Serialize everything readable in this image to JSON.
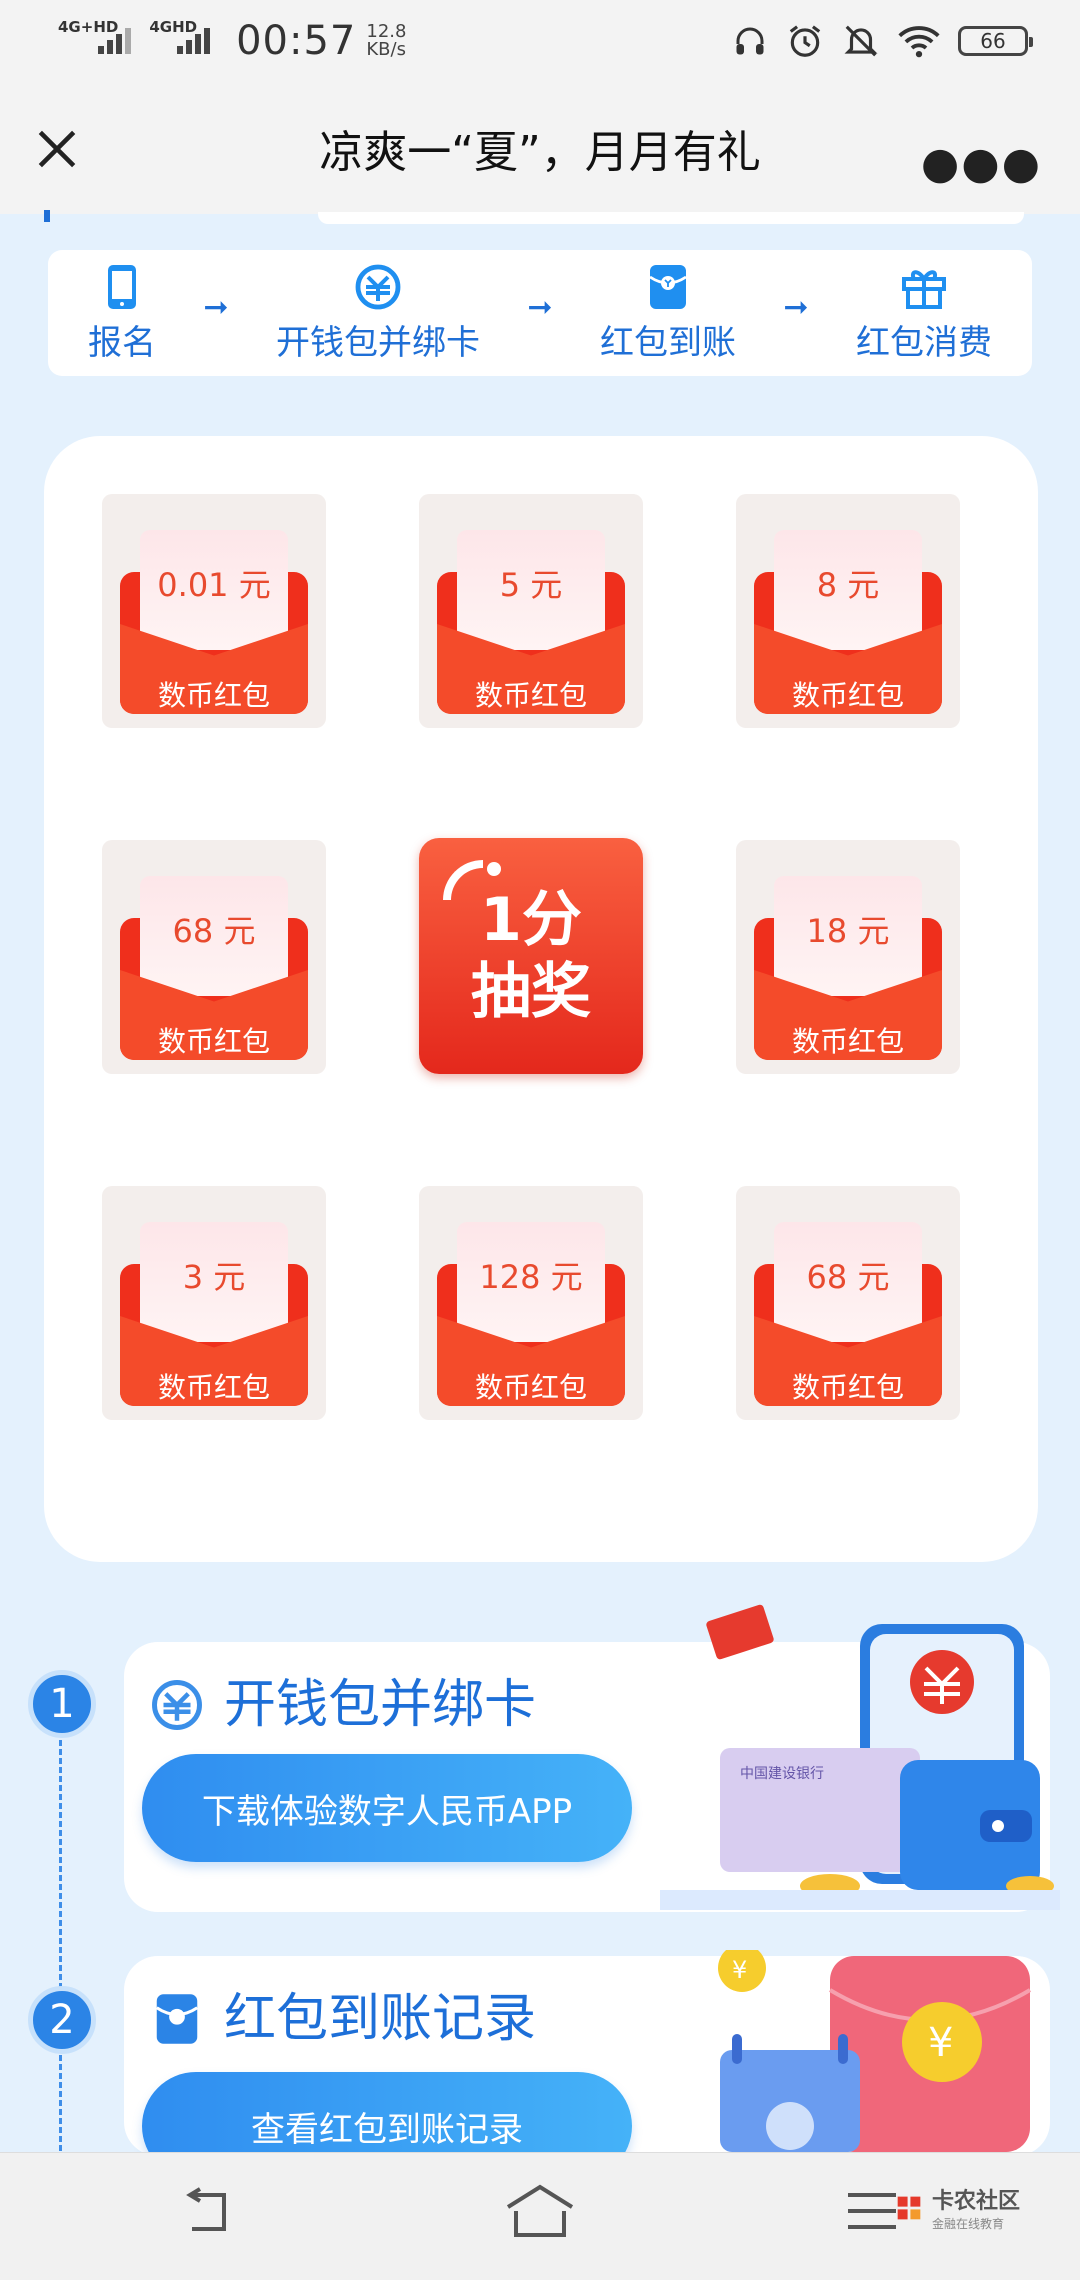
{
  "status_bar": {
    "signal1_label": "4G+HD",
    "signal2_label": "4GHD",
    "time": "00:57",
    "speed_value": "12.8",
    "speed_unit": "KB/s",
    "battery": "66"
  },
  "title_bar": {
    "title": "凉爽一“夏”，月月有礼"
  },
  "steps": [
    {
      "label": "报名",
      "icon": "phone-icon"
    },
    {
      "label": "开钱包并绑卡",
      "icon": "digital-rmb-icon"
    },
    {
      "label": "红包到账",
      "icon": "red-envelope-icon"
    },
    {
      "label": "红包消费",
      "icon": "gift-icon"
    }
  ],
  "lottery": {
    "prizes": [
      {
        "amount": "0.01 元",
        "label": "数币红包"
      },
      {
        "amount": "5 元",
        "label": "数币红包"
      },
      {
        "amount": "8 元",
        "label": "数币红包"
      },
      {
        "amount": "68 元",
        "label": "数币红包"
      },
      {
        "amount": "18 元",
        "label": "数币红包"
      },
      {
        "amount": "3 元",
        "label": "数币红包"
      },
      {
        "amount": "128 元",
        "label": "数币红包"
      },
      {
        "amount": "68 元",
        "label": "数币红包"
      }
    ],
    "draw_button": {
      "line1": "1分",
      "line2": "抽奖"
    }
  },
  "tasks": [
    {
      "number": "1",
      "title": "开钱包并绑卡",
      "button": "下载体验数字人民币APP"
    },
    {
      "number": "2",
      "title": "红包到账记录",
      "button": "查看红包到账记录"
    }
  ],
  "watermark": {
    "name": "卡农社区",
    "sub": "金融在线教育"
  },
  "colors": {
    "accent_blue": "#1f6fd6",
    "envelope_red": "#f44b2a",
    "page_bg": "#e4f1fd"
  }
}
